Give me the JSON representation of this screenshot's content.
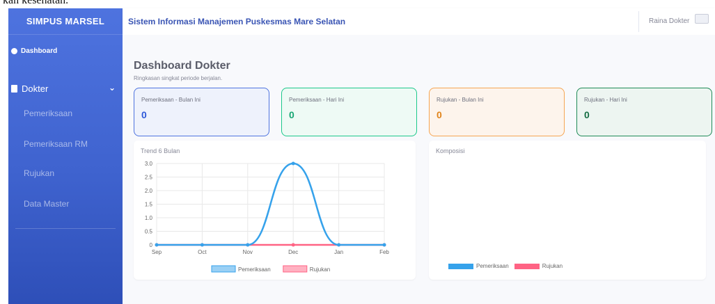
{
  "clipped_header_text": "kan kesehatan.",
  "sidebar": {
    "brand": "SIMPUS MARSEL",
    "dashboard_label": "Dashboard",
    "dokter_label": "Dokter",
    "items": [
      {
        "label": "Pemeriksaan"
      },
      {
        "label": "Pemeriksaan RM"
      },
      {
        "label": "Rujukan"
      },
      {
        "label": "Data Master"
      }
    ]
  },
  "topbar": {
    "title": "Sistem Informasi Manajemen Puskesmas Mare Selatan",
    "user_name": "Raina Dokter"
  },
  "page": {
    "title": "Dashboard Dokter",
    "subtitle": "Ringkasan singkat periode berjalan."
  },
  "kpis": [
    {
      "label": "Pemeriksaan - Bulan Ini",
      "value": "0",
      "border": "#4e73df",
      "bg": "#eef2fc",
      "color": "#2e59d9"
    },
    {
      "label": "Pemeriksaan - Hari Ini",
      "value": "0",
      "border": "#1cc88a",
      "bg": "#eefaf5",
      "color": "#17a673"
    },
    {
      "label": "Rujukan - Bulan Ini",
      "value": "0",
      "border": "#f6a552",
      "bg": "#fdf4ec",
      "color": "#e0841b"
    },
    {
      "label": "Rujukan - Hari Ini",
      "value": "0",
      "border": "#1e8a56",
      "bg": "#edf5f1",
      "color": "#166e44"
    }
  ],
  "trend_card": {
    "title": "Trend 6 Bulan"
  },
  "composition_card": {
    "title": "Komposisi"
  },
  "chart_data": [
    {
      "type": "line",
      "title": "Trend 6 Bulan",
      "categories": [
        "Sep",
        "Oct",
        "Nov",
        "Dec",
        "Jan",
        "Feb"
      ],
      "series": [
        {
          "name": "Pemeriksaan",
          "values": [
            0,
            0,
            0,
            3,
            0,
            0
          ],
          "color": "#36a2eb"
        },
        {
          "name": "Rujukan",
          "values": [
            0,
            0,
            0,
            0,
            0,
            0
          ],
          "color": "#ff6384"
        }
      ],
      "yticks": [
        "3.0",
        "2.5",
        "2.0",
        "1.5",
        "1.0",
        "0.5",
        "0"
      ],
      "ylim": [
        0,
        3
      ],
      "grid": true,
      "legend": "bottom"
    },
    {
      "type": "pie",
      "title": "Komposisi",
      "series": [
        {
          "name": "Pemeriksaan",
          "value": 0,
          "color": "#36a2eb"
        },
        {
          "name": "Rujukan",
          "value": 0,
          "color": "#ff6384"
        }
      ],
      "legend": "bottom"
    }
  ]
}
